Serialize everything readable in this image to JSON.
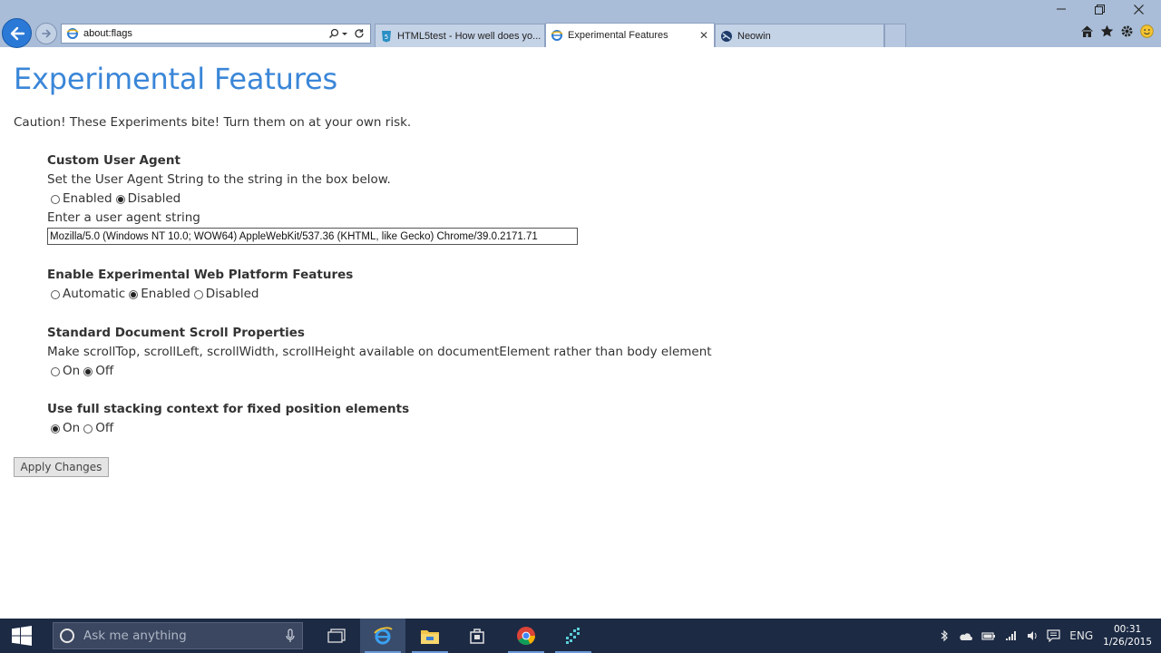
{
  "browser": {
    "address": "about:flags",
    "tabs": [
      {
        "label": "HTML5test - How well does yo..."
      },
      {
        "label": "Experimental Features",
        "close": "✕"
      },
      {
        "label": "Neowin"
      }
    ]
  },
  "page": {
    "title": "Experimental Features",
    "caution": "Caution! These Experiments bite! Turn them on at your own risk.",
    "sections": [
      {
        "title": "Custom User Agent",
        "description": "Set the User Agent String to the string in the box below.",
        "options": [
          "Enabled",
          "Disabled"
        ],
        "selected": "Disabled",
        "input_label": "Enter a user agent string",
        "input_value": "Mozilla/5.0 (Windows NT 10.0; WOW64) AppleWebKit/537.36 (KHTML, like Gecko) Chrome/39.0.2171.71"
      },
      {
        "title": "Enable Experimental Web Platform Features",
        "options": [
          "Automatic",
          "Enabled",
          "Disabled"
        ],
        "selected": "Enabled"
      },
      {
        "title": "Standard Document Scroll Properties",
        "description": "Make scrollTop, scrollLeft, scrollWidth, scrollHeight available on documentElement rather than body element",
        "options": [
          "On",
          "Off"
        ],
        "selected": "Off"
      },
      {
        "title": "Use full stacking context for fixed position elements",
        "options": [
          "On",
          "Off"
        ],
        "selected": "On"
      }
    ],
    "apply_label": "Apply Changes"
  },
  "taskbar": {
    "search_placeholder": "Ask me anything",
    "language": "ENG",
    "time": "00:31",
    "date": "1/26/2015"
  },
  "colors": {
    "title_blue": "#3a86d8",
    "chrome": "#a9bdd8",
    "taskbar": "#1c2a44"
  }
}
